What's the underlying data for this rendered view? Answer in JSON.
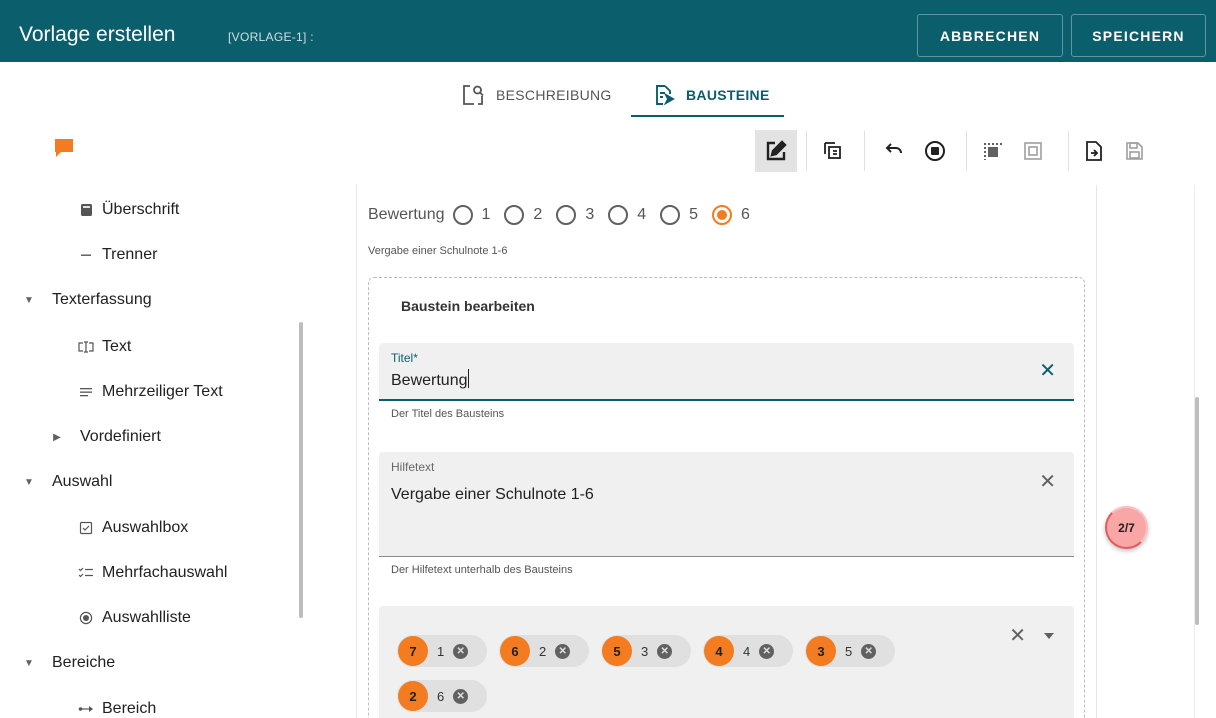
{
  "header": {
    "title": "Vorlage erstellen",
    "template_id": "[VORLAGE-1] :",
    "cancel_label": "ABBRECHEN",
    "save_label": "SPEICHERN"
  },
  "tabs": [
    {
      "label": "BESCHREIBUNG",
      "icon": "description-icon",
      "active": false
    },
    {
      "label": "BAUSTEINE",
      "icon": "blocks-icon",
      "active": true
    }
  ],
  "toolbar": {
    "icons": [
      "comment-icon",
      "edit-icon",
      "copy-icon",
      "undo-icon",
      "stop-icon",
      "select-all-icon",
      "select-block-icon",
      "import-icon",
      "save-icon"
    ]
  },
  "sidebar": {
    "items": [
      {
        "label": "Überschrift",
        "icon": "heading-icon"
      },
      {
        "label": "Trenner",
        "icon": "divider-icon"
      },
      {
        "label": "Texterfassung",
        "expanded": true
      },
      {
        "label": "Text",
        "icon": "text-field-icon"
      },
      {
        "label": "Mehrzeiliger Text",
        "icon": "multiline-icon"
      },
      {
        "label": "Vordefiniert",
        "expanded": false
      },
      {
        "label": "Auswahl",
        "expanded": true
      },
      {
        "label": "Auswahlbox",
        "icon": "checkbox-icon"
      },
      {
        "label": "Mehrfachauswahl",
        "icon": "checklist-icon"
      },
      {
        "label": "Auswahlliste",
        "icon": "radio-icon"
      },
      {
        "label": "Bereiche",
        "expanded": true
      },
      {
        "label": "Bereich",
        "icon": "range-icon"
      }
    ]
  },
  "rating": {
    "label": "Bewertung",
    "options": [
      "1",
      "2",
      "3",
      "4",
      "5",
      "6"
    ],
    "selected": "6",
    "help": "Vergabe einer Schulnote 1-6"
  },
  "editor": {
    "title": "Baustein bearbeiten",
    "title_field": {
      "label": "Titel*",
      "value": "Bewertung",
      "hint": "Der Titel des Bausteins"
    },
    "help_field": {
      "label": "Hilfetext",
      "value": "Vergabe einer Schulnote 1-6",
      "hint": "Der Hilfetext unterhalb des Bausteins"
    },
    "chips": [
      {
        "badge": "7",
        "text": "1"
      },
      {
        "badge": "6",
        "text": "2"
      },
      {
        "badge": "5",
        "text": "3"
      },
      {
        "badge": "4",
        "text": "4"
      },
      {
        "badge": "3",
        "text": "5"
      },
      {
        "badge": "2",
        "text": "6"
      }
    ]
  },
  "counter": "2/7",
  "colors": {
    "primary": "#0b5e6b",
    "accent": "#f27c1f",
    "counter": "#f8a6a6"
  }
}
